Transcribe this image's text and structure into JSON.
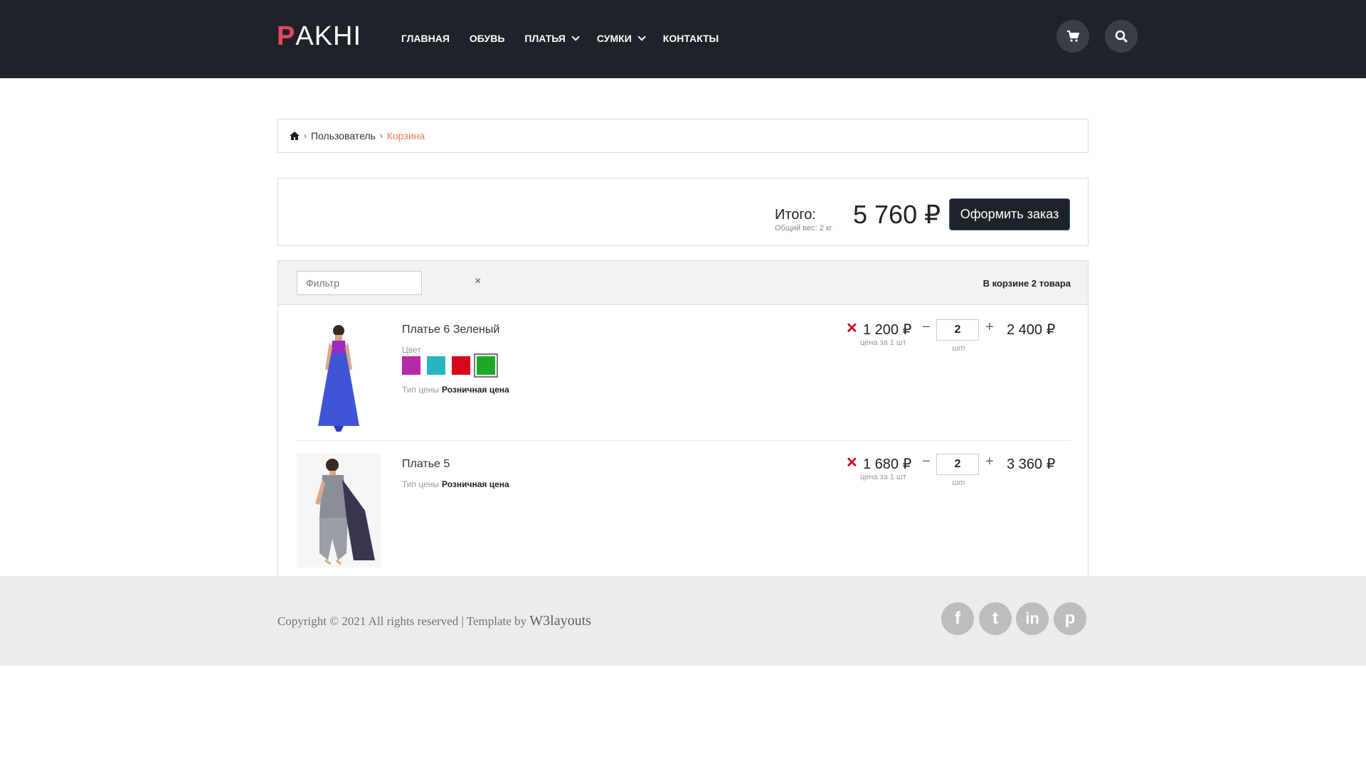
{
  "header": {
    "logo_first": "P",
    "logo_rest": "AKHI",
    "nav": [
      {
        "label": "ГЛАВНАЯ"
      },
      {
        "label": "ОБУВЬ"
      },
      {
        "label": "ПЛАТЬЯ"
      },
      {
        "label": "СУМКИ"
      },
      {
        "label": "КОНТАКТЫ"
      }
    ]
  },
  "breadcrumb": {
    "items": [
      "Пользователь",
      "Корзина"
    ]
  },
  "summary": {
    "total_label": "Итого:",
    "weight_text": "Общий вес: 2 кг",
    "total_sum": "5 760 ₽",
    "checkout_label": "Оформить заказ"
  },
  "cart": {
    "filter_placeholder": "Фильтр",
    "clear_label": "×",
    "count_text": "В корзине 2 товара",
    "items": [
      {
        "title": "Платье 6 Зеленый",
        "color_label": "Цвет",
        "price_type_label": "Тип цены",
        "price_type": "Розничная цена",
        "unit_price": "1 200 ₽",
        "unit_label": "цена за 1 шт",
        "qty": "2",
        "qty_unit": "шт",
        "line_total": "2 400 ₽",
        "swatches": [
          "#b52aa8",
          "#27b6bf",
          "#d8061c",
          "#1fa827"
        ],
        "selected_swatch": 3
      },
      {
        "title": "Платье 5",
        "price_type_label": "Тип цены",
        "price_type": "Розничная цена",
        "unit_price": "1 680 ₽",
        "unit_label": "цена за 1 шт",
        "qty": "2",
        "qty_unit": "шт",
        "line_total": "3 360 ₽"
      }
    ]
  },
  "footer": {
    "copyright": "Copyright © 2021 All rights reserved | Template by",
    "brand": "W3layouts",
    "social": [
      {
        "icon": "facebook-icon",
        "glyph": "f"
      },
      {
        "icon": "twitter-icon",
        "glyph": "t"
      },
      {
        "icon": "linkedin-icon",
        "glyph": "in"
      },
      {
        "icon": "pinterest-icon",
        "glyph": "p"
      }
    ]
  },
  "colors": {
    "header_bg": "#1e2329",
    "accent": "#e8475f",
    "breadcrumb_current": "#f07a5a",
    "remove": "#d0021b"
  }
}
